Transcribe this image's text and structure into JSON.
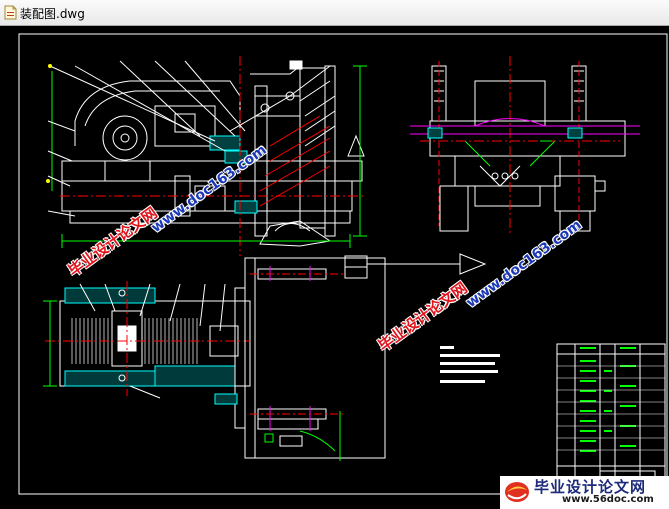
{
  "window": {
    "title": "装配图.dwg"
  },
  "watermarks": {
    "site_cn": "毕业设计论文网",
    "site_url": "www.doc163.com"
  },
  "logo": {
    "cn": "毕业设计论文网",
    "url": "www.56doc.com"
  },
  "colors": {
    "background": "#000000",
    "frame": "#ffffff",
    "dimension": "#00ff00",
    "centerline": "#ff0000",
    "highlight": "#ff00ff",
    "part": "#00ffff",
    "accent": "#ffff00"
  },
  "icons": {
    "document": "dwg-document-icon",
    "logo": "swirl-ball-icon"
  }
}
